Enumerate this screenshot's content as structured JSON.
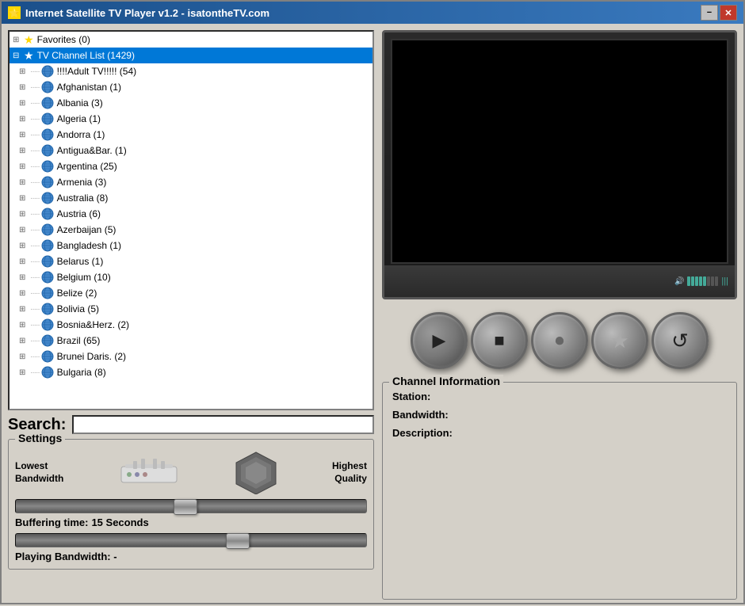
{
  "window": {
    "title": "Internet Satellite TV Player v1.2 - isatontheTV.com",
    "minimize_label": "−",
    "close_label": "✕"
  },
  "tree": {
    "favorites_label": "Favorites (0)",
    "channel_list_label": "TV Channel List (1429)",
    "items": [
      {
        "label": "!!!!Adult TV!!!!! (54)"
      },
      {
        "label": "Afghanistan (1)"
      },
      {
        "label": "Albania (3)"
      },
      {
        "label": "Algeria (1)"
      },
      {
        "label": "Andorra (1)"
      },
      {
        "label": "Antigua&Bar. (1)"
      },
      {
        "label": "Argentina (25)"
      },
      {
        "label": "Armenia (3)"
      },
      {
        "label": "Australia (8)"
      },
      {
        "label": "Austria (6)"
      },
      {
        "label": "Azerbaijan (5)"
      },
      {
        "label": "Bangladesh (1)"
      },
      {
        "label": "Belarus (1)"
      },
      {
        "label": "Belgium (10)"
      },
      {
        "label": "Belize (2)"
      },
      {
        "label": "Bolivia (5)"
      },
      {
        "label": "Bosnia&Herz. (2)"
      },
      {
        "label": "Brazil (65)"
      },
      {
        "label": "Brunei Daris. (2)"
      },
      {
        "label": "Bulgaria (8)"
      }
    ]
  },
  "search": {
    "label": "Search:",
    "placeholder": ""
  },
  "settings": {
    "legend": "Settings",
    "lowest_bandwidth": "Lowest\nBandwidth",
    "highest_quality": "Highest\nQuality",
    "buffering_label": "Buffering time:",
    "buffering_value": "15 Seconds",
    "playing_label": "Playing Bandwidth: -"
  },
  "controls": {
    "play_icon": "▶",
    "stop_icon": "■",
    "record_icon": "⏺",
    "favorite_icon": "★",
    "refresh_icon": "↺"
  },
  "channel_info": {
    "legend": "Channel Information",
    "station_label": "Station:",
    "station_value": "",
    "bandwidth_label": "Bandwidth:",
    "bandwidth_value": "",
    "description_label": "Description:",
    "description_value": ""
  },
  "colors": {
    "selected_bg": "#0078d7",
    "titlebar_start": "#1a4f8a",
    "titlebar_end": "#3a7abf"
  }
}
